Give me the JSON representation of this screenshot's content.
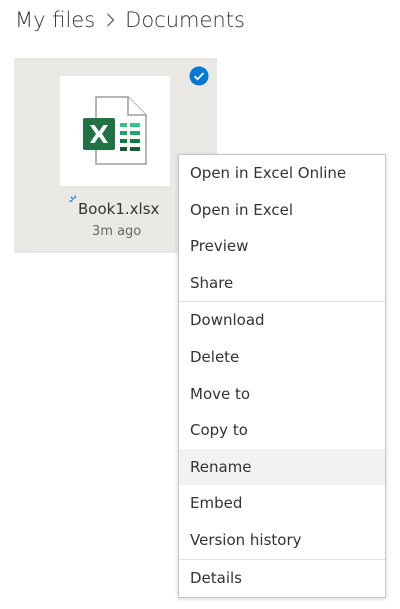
{
  "breadcrumb": {
    "root": "My files",
    "current": "Documents"
  },
  "file": {
    "name": "Book1.xlsx",
    "modified": "3m ago",
    "icon": "excel-file-icon",
    "selected": true,
    "status_icon": "sync-icon"
  },
  "colors": {
    "excel_green": "#217346",
    "check_blue": "#0078d4",
    "tile_bg": "#ebe9e6",
    "menu_hover": "#f3f2f1"
  },
  "context_menu": {
    "groups": [
      {
        "items": [
          "Open in Excel Online",
          "Open in Excel",
          "Preview",
          "Share"
        ]
      },
      {
        "items": [
          "Download",
          "Delete",
          "Move to",
          "Copy to",
          "Rename",
          "Embed",
          "Version history"
        ]
      },
      {
        "items": [
          "Details"
        ]
      }
    ],
    "highlighted": "Rename"
  }
}
